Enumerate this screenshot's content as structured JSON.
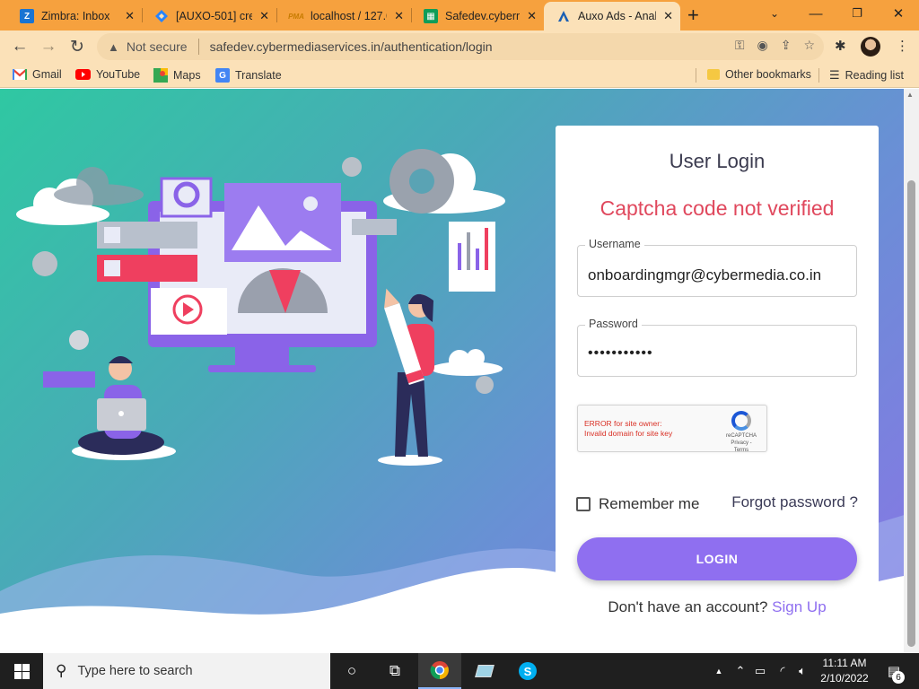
{
  "browser": {
    "tabs": [
      {
        "title": "Zimbra: Inbox",
        "icon": "zimbra-icon",
        "active": false
      },
      {
        "title": "[AUXO-501] cre",
        "icon": "jira-icon",
        "active": false
      },
      {
        "title": "localhost / 127.0",
        "icon": "phpmyadmin-icon",
        "active": false
      },
      {
        "title": "Safedev.cyberm",
        "icon": "sheets-icon",
        "active": false
      },
      {
        "title": "Auxo Ads - Anal",
        "icon": "auxo-icon",
        "active": true
      }
    ],
    "security_label": "Not secure",
    "url": "safedev.cybermediaservices.in/authentication/login",
    "bookmarks": [
      {
        "label": "Gmail",
        "icon": "gmail-icon"
      },
      {
        "label": "YouTube",
        "icon": "youtube-icon"
      },
      {
        "label": "Maps",
        "icon": "maps-icon"
      },
      {
        "label": "Translate",
        "icon": "translate-icon"
      }
    ],
    "other_bookmarks": "Other bookmarks",
    "reading_list": "Reading list"
  },
  "login": {
    "title": "User Login",
    "error": "Captcha code not verified",
    "username_label": "Username",
    "username_value": "onboardingmgr@cybermedia.co.in",
    "password_label": "Password",
    "password_value": "•••••••••••",
    "recaptcha_error_line1": "ERROR for site owner:",
    "recaptcha_error_line2": "Invalid domain for site key",
    "recaptcha_brand": "reCAPTCHA",
    "recaptcha_links": "Privacy - Terms",
    "remember_label": "Remember me",
    "forgot_label": "Forgot password ?",
    "login_button": "LOGIN",
    "no_account": "Don't have an account?",
    "signup": "Sign Up"
  },
  "taskbar": {
    "search_placeholder": "Type here to search",
    "time": "11:11 AM",
    "date": "2/10/2022",
    "notification_count": "6"
  },
  "colors": {
    "tab_bar": "#f6a13e",
    "toolbar": "#fbe1b8",
    "error": "#e0485d",
    "accent": "#8f6ff0"
  }
}
